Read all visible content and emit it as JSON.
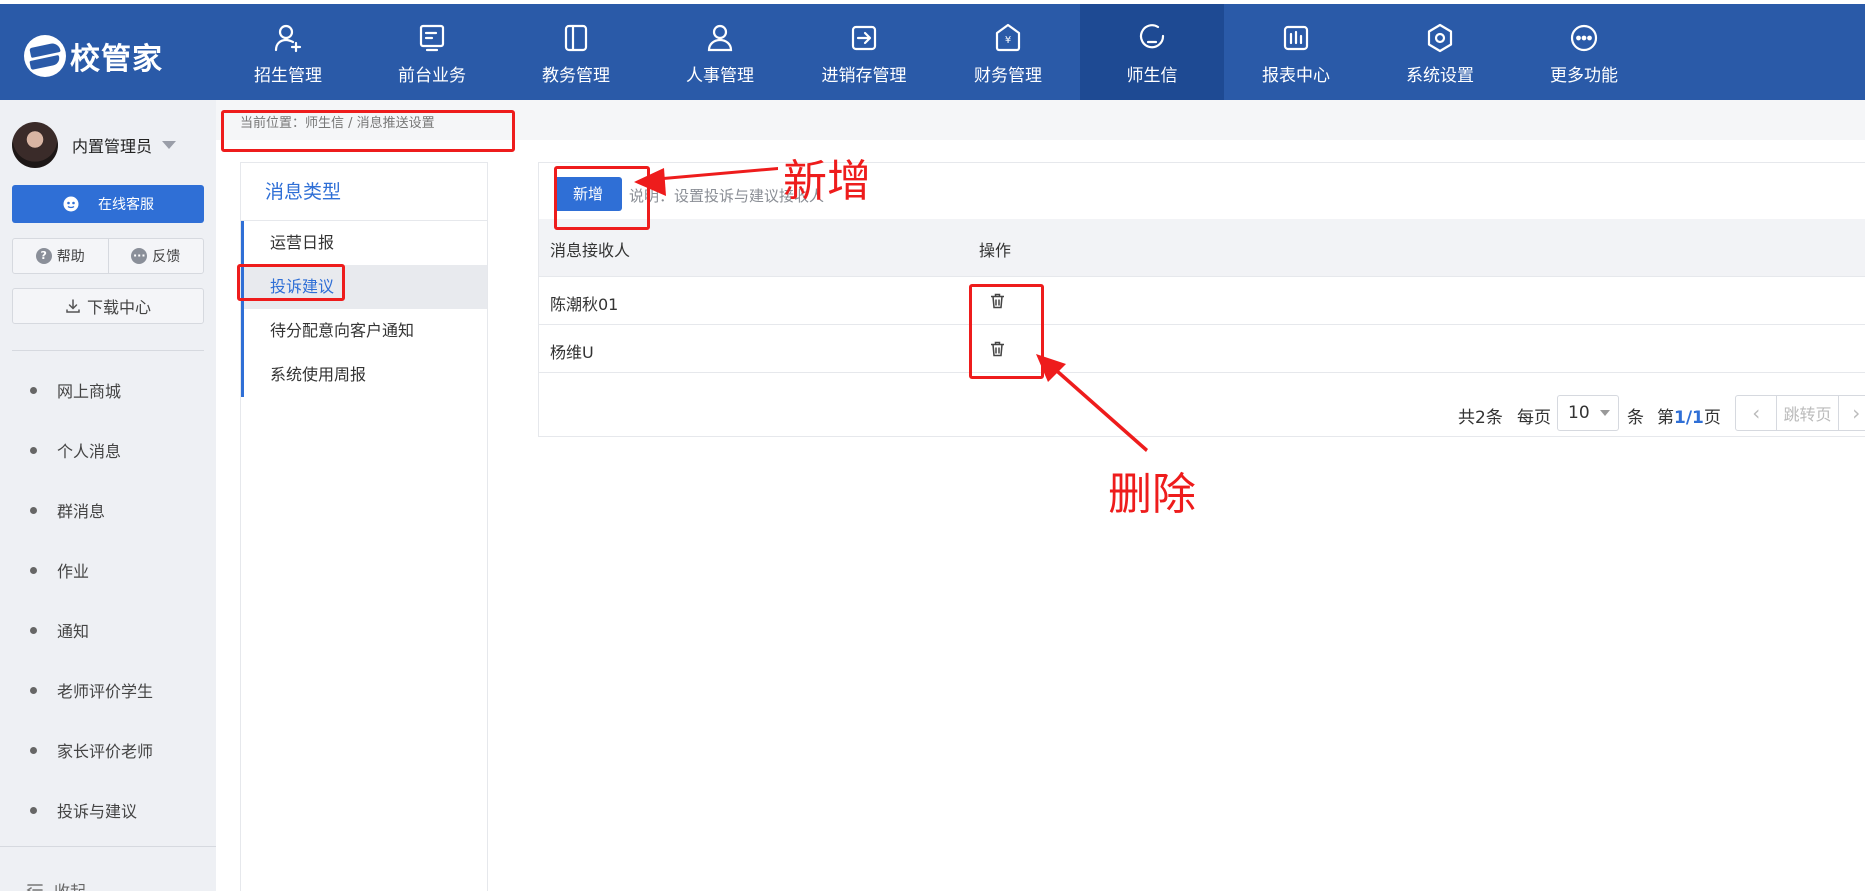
{
  "brand": {
    "name": "校管家",
    "color": "#2a5aa8"
  },
  "nav": {
    "items": [
      {
        "label": "招生管理",
        "icon": "user-add-icon"
      },
      {
        "label": "前台业务",
        "icon": "monitor-icon"
      },
      {
        "label": "教务管理",
        "icon": "book-icon"
      },
      {
        "label": "人事管理",
        "icon": "person-icon"
      },
      {
        "label": "进销存管理",
        "icon": "arrow-box-icon"
      },
      {
        "label": "财务管理",
        "icon": "yuan-house-icon"
      },
      {
        "label": "师生信",
        "icon": "chat-bubble-icon",
        "active": true
      },
      {
        "label": "报表中心",
        "icon": "bar-chart-icon"
      },
      {
        "label": "系统设置",
        "icon": "hexagon-gear-icon"
      },
      {
        "label": "更多功能",
        "icon": "more-circle-icon"
      }
    ]
  },
  "sidebar": {
    "user_name": "内置管理员",
    "service_label": "在线客服",
    "help_label": "帮助",
    "feedback_label": "反馈",
    "download_label": "下载中心",
    "menu": [
      "网上商城",
      "个人消息",
      "群消息",
      "作业",
      "通知",
      "老师评价学生",
      "家长评价老师",
      "投诉与建议"
    ],
    "collapse_label": "收起"
  },
  "breadcrumb": "当前位置：师生信 / 消息推送设置",
  "types": {
    "title": "消息类型",
    "items": [
      "运营日报",
      "投诉建议",
      "待分配意向客户通知",
      "系统使用周报"
    ],
    "active_index": 1
  },
  "main": {
    "add_label": "新增",
    "note": "说明：设置投诉与建议接收人",
    "columns": [
      "消息接收人",
      "操作"
    ],
    "rows": [
      {
        "name": "陈潮秋01"
      },
      {
        "name": "杨维U"
      }
    ]
  },
  "pagination": {
    "total": "共2条",
    "per_page_label": "每页",
    "per_page": "10",
    "unit": "条",
    "page_prefix": "第",
    "page_current": "1/1",
    "page_suffix": "页",
    "jump_label": "跳转页"
  },
  "annotations": {
    "add_text": "新增",
    "delete_text": "删除",
    "color": "#ee1c1c"
  },
  "colors": {
    "accent": "#2f6fd6",
    "nav_bg": "#2a5aa8",
    "nav_active": "#1e4a93",
    "sidebar_bg": "#eef0f4"
  }
}
